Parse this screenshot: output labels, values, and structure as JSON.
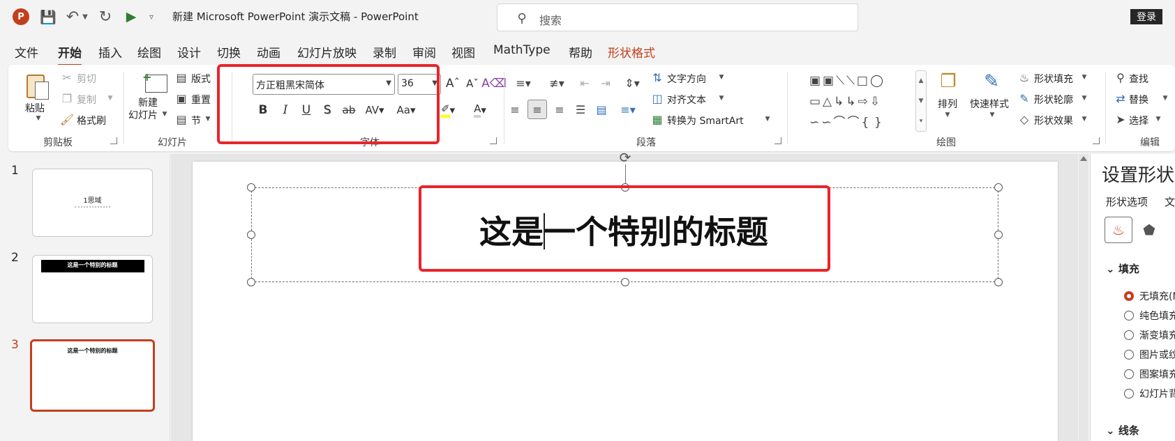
{
  "app": {
    "logo_letter": "P",
    "doc_title": "新建 Microsoft PowerPoint 演示文稿  -  PowerPoint",
    "search_placeholder": "搜索",
    "login": "登录"
  },
  "tabs": [
    "文件",
    "开始",
    "插入",
    "绘图",
    "设计",
    "切换",
    "动画",
    "幻灯片放映",
    "录制",
    "审阅",
    "视图",
    "MathType",
    "帮助",
    "形状格式"
  ],
  "active_tab": "开始",
  "ribbon": {
    "clipboard": {
      "paste": "粘贴",
      "cut": "剪切",
      "copy": "复制",
      "format_painter": "格式刷",
      "group": "剪贴板"
    },
    "slides": {
      "new_slide": "新建",
      "new_slide_2": "幻灯片",
      "layout": "版式",
      "reset": "重置",
      "section": "节",
      "group": "幻灯片"
    },
    "font": {
      "font_name": "方正粗黑宋简体",
      "font_size": "36",
      "group": "字体"
    },
    "paragraph": {
      "text_direction": "文字方向",
      "align_text": "对齐文本",
      "smartart": "转换为 SmartArt",
      "group": "段落"
    },
    "drawing": {
      "arrange": "排列",
      "quick_styles": "快速样式",
      "shape_fill": "形状填充",
      "shape_outline": "形状轮廓",
      "shape_effects": "形状效果",
      "group": "绘图"
    },
    "editing": {
      "find": "查找",
      "replace": "替换",
      "select": "选择",
      "group": "编辑"
    }
  },
  "slides": [
    {
      "number": "1",
      "title": "1思域"
    },
    {
      "number": "2",
      "title": "这是一个特别的标题"
    },
    {
      "number": "3",
      "title": "这是一个特别的标题"
    }
  ],
  "current_slide_title": "这是一个特别的标题",
  "pane": {
    "title": "设置形状",
    "tab_shape": "形状选项",
    "tab_text": "文",
    "fill_header": "填充",
    "fill_options": [
      "无填充(N",
      "纯色填充",
      "渐变填充",
      "图片或纹",
      "图案填充",
      "幻灯片背"
    ],
    "line_header": "线条"
  },
  "colors": {
    "accent": "#c43e1c",
    "highlight_box": "#e8252b"
  }
}
